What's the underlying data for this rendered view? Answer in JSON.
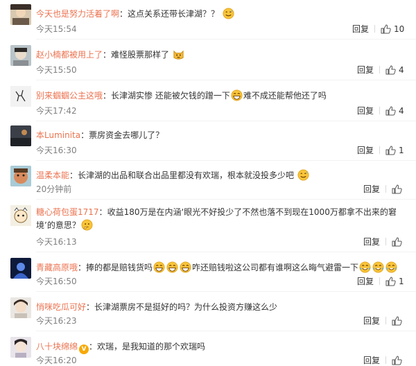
{
  "comments": [
    {
      "username": "今天也是努力活着了啊",
      "text": "这点关系还带长津湖？？",
      "emojis_after": [
        "sweat-smile-emoji"
      ],
      "time": "今天15:54",
      "reply": "回复",
      "likes": "10"
    },
    {
      "username": "赵小楠都被用上了",
      "text": "难怪股票那样了",
      "emojis_after": [
        "cat-emoji"
      ],
      "time": "今天15:50",
      "reply": "回复",
      "likes": "4"
    },
    {
      "username": "别来蝈蝈公主这哦",
      "text": "长津湖实惨 还能被欠钱的蹭一下",
      "emoji_mid": "grin-emoji",
      "text2": "难不成还能帮他还了吗",
      "time": "今天17:42",
      "reply": "回复",
      "likes": "4"
    },
    {
      "username": "本Luminita",
      "text": "票房资金去哪儿了？",
      "time": "今天16:30",
      "reply": "回复",
      "likes": "1"
    },
    {
      "username": "温柔本能",
      "text": "长津湖的出品和联合出品里都没有欢瑞，根本就没投多少吧",
      "emojis_after": [
        "sweat-smile-emoji"
      ],
      "time": "20分钟前",
      "reply": "回复",
      "likes": ""
    },
    {
      "username": "糖心荷包蛋1717",
      "text": "收益180万是在内涵‘眼光不好投少了不然也落不到现在1000万都拿不出来的窘境’的意思？",
      "emojis_after": [
        "think-emoji"
      ],
      "time": "今天16:13",
      "reply": "回复",
      "likes": ""
    },
    {
      "username": "青藏高原哦",
      "text": "捧的都是赔钱货吗",
      "emojis_mid": [
        "laugh-emoji",
        "laugh-emoji",
        "laugh-emoji"
      ],
      "text2": "咋还赔钱啦这公司都有谁啊这么晦气避雷一下",
      "emojis_after": [
        "cry-laugh-emoji",
        "cry-laugh-emoji",
        "cry-laugh-emoji"
      ],
      "time": "今天16:50",
      "reply": "回复",
      "likes": "1"
    },
    {
      "username": "悄咪吃瓜可好",
      "text": "长津湖票房不是挺好的吗？为什么投资方赚这么少",
      "time": "今天16:23",
      "reply": "回复",
      "likes": ""
    },
    {
      "username": "八十块绵绵",
      "badge": "V",
      "text": "欢瑞，是我知道的那个欢瑞吗",
      "time": "今天16:20",
      "reply": "回复",
      "likes": ""
    }
  ],
  "colors": {
    "username": "#eb7350",
    "time": "#808080",
    "text": "#333333"
  }
}
